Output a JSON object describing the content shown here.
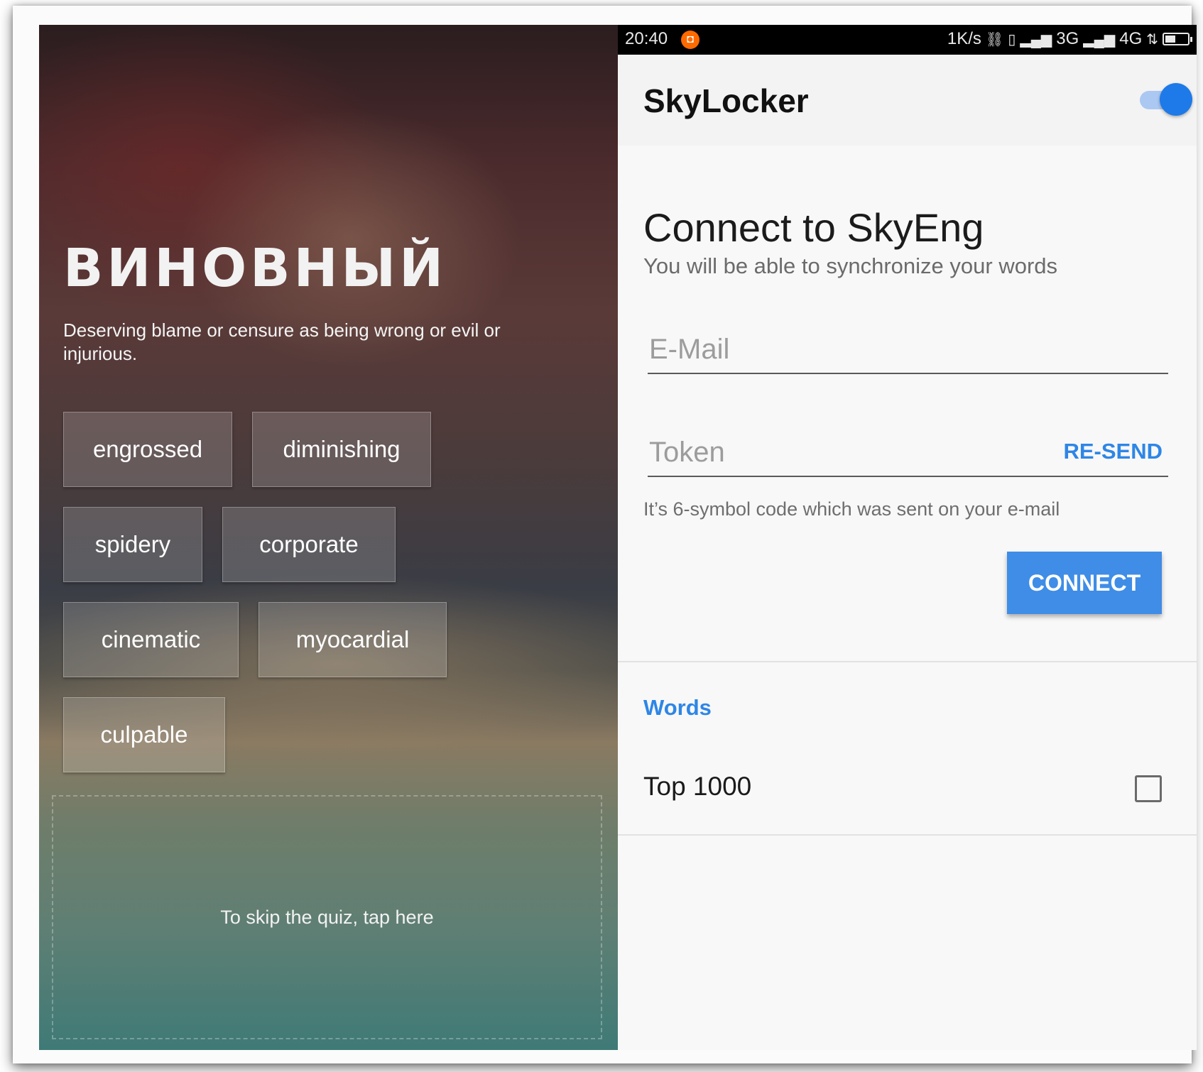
{
  "quiz": {
    "word": "ВИНОВНЫЙ",
    "definition": "Deserving blame or censure as being wrong or evil or injurious.",
    "options": [
      [
        "engrossed",
        "diminishing"
      ],
      [
        "spidery",
        "corporate"
      ],
      [
        "cinematic",
        "myocardial"
      ],
      [
        "culpable"
      ]
    ],
    "skip_text": "To skip the quiz, tap here"
  },
  "statusbar": {
    "time": "20:40",
    "notification_icon": "orange-app-icon",
    "speed": "1K/s",
    "network_3g": "3G",
    "network_4g": "4G",
    "battery_level": 0.45
  },
  "appbar": {
    "title": "SkyLocker",
    "toggle_on": true
  },
  "connect": {
    "title": "Connect to SkyEng",
    "subtitle": "You will be able to synchronize your words",
    "email_placeholder": "E-Mail",
    "token_placeholder": "Token",
    "resend_label": "RE-SEND",
    "hint": "It’s 6-symbol code which was sent on your e-mail",
    "button_label": "CONNECT"
  },
  "words": {
    "section_label": "Words",
    "item_label": "Top 1000",
    "item_checked": false
  },
  "colors": {
    "accent": "#2e86e6",
    "button": "#3f8de6",
    "toggle_thumb": "#1e7ae8",
    "notification": "#ff6a00"
  }
}
